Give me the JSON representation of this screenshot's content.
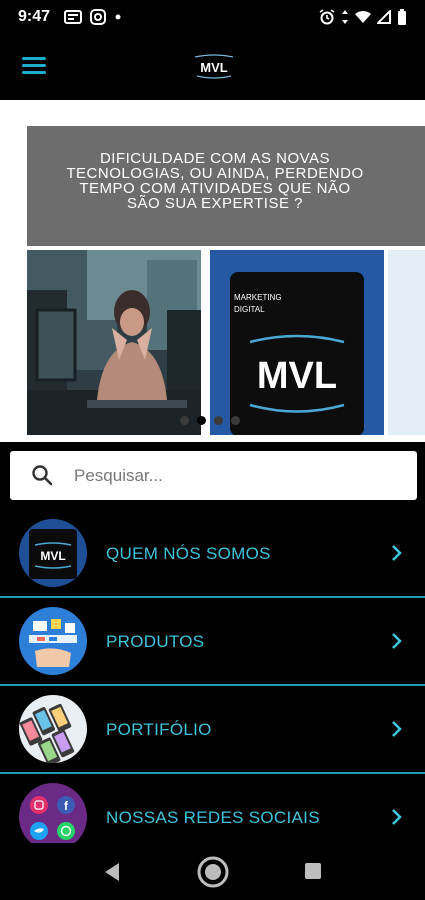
{
  "status": {
    "time": "9:47"
  },
  "app_bar": {
    "logo_text": "MVL"
  },
  "banner": {
    "headline_lines": [
      "DIFICULDADE COM AS NOVAS",
      "TECNOLOGIAS, OU AINDA, PERDENDO",
      "TEMPO COM ATIVIDADES QUE NÃO",
      "SÃO SUA EXPERTISE ?"
    ],
    "card_caption_line1": "MARKETING",
    "card_caption_line2": "DIGITAL",
    "card_logo": "MVL",
    "slides_count": 4,
    "active_slide": 2
  },
  "search": {
    "placeholder": "Pesquisar..."
  },
  "menu": [
    {
      "label": "QUEM NÓS SOMOS",
      "icon": "mvl-logo-thumb"
    },
    {
      "label": "PRODUTOS",
      "icon": "products-thumb"
    },
    {
      "label": "PORTIFÓLIO",
      "icon": "portfolio-thumb"
    },
    {
      "label": "NOSSAS REDES SOCIAIS",
      "icon": "social-thumb"
    }
  ],
  "colors": {
    "accent": "#3fc4dc",
    "separator": "#1a9cb6",
    "banner_gray": "#6d6d6d",
    "card_blue": "#2559a4"
  }
}
